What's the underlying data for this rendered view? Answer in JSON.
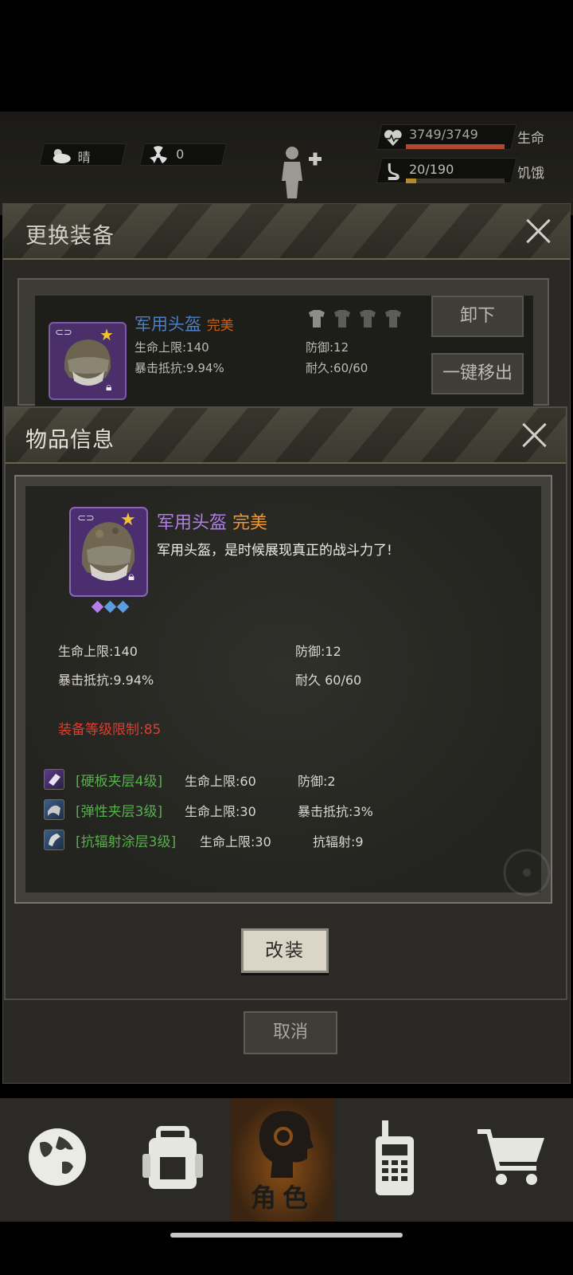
{
  "hud": {
    "weather_label": "晴",
    "radiation_value": "0",
    "health_value": "3749/3749",
    "health_label": "生命",
    "health_fraction": 1.0,
    "hunger_value": "20/190",
    "hunger_label": "饥饿",
    "hunger_fraction": 0.105
  },
  "change_equipment_dialog": {
    "title": "更换装备",
    "item_name": "军用头盔",
    "item_quality": "完美",
    "stat_hp": "生命上限:140",
    "stat_crit_resist": "暴击抵抗:9.94%",
    "stat_defense": "防御:12",
    "stat_durability": "耐久:60/60",
    "unequip_label": "卸下",
    "remove_all_label": "一键移出",
    "cancel_label": "取消"
  },
  "item_info_dialog": {
    "title": "物品信息",
    "item_name": "军用头盔",
    "item_quality": "完美",
    "description": "军用头盔，是时候展现真正的战斗力了!",
    "stat_hp": "生命上限:140",
    "stat_defense": "防御:12",
    "stat_crit_resist": "暴击抵抗:9.94%",
    "stat_durability": "耐久 60/60",
    "level_requirement": "装备等级限制:85",
    "mods": [
      {
        "name": "[硬板夹层4级]",
        "stat1": "生命上限:60",
        "stat2": "防御:2"
      },
      {
        "name": "[弹性夹层3级]",
        "stat1": "生命上限:30",
        "stat2": "暴击抵抗:3%"
      },
      {
        "name": "[抗辐射涂层3级]",
        "stat1": "生命上限:30",
        "stat2": "抗辐射:9"
      }
    ],
    "modify_label": "改装"
  },
  "bottom_nav": {
    "active_label": "角色"
  },
  "colors": {
    "quality_orange": "#f0962f",
    "item_purple": "#b07fe6",
    "requirement_red": "#e03c2e",
    "mod_green": "#58b04d",
    "health_bar": "#b0492f",
    "hunger_bar": "#b38a2e"
  }
}
